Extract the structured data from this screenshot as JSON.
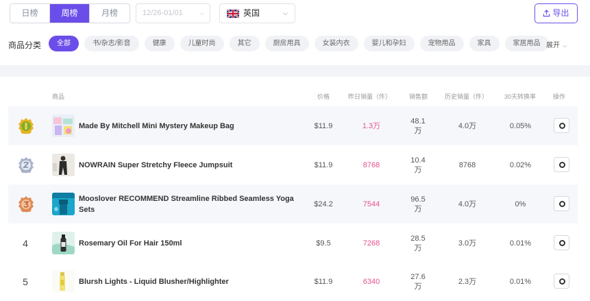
{
  "period_tabs": [
    "日榜",
    "周榜",
    "月榜"
  ],
  "active_period_index": 1,
  "date_range": "12/26-01/01",
  "country": "英国",
  "export_label": "导出",
  "category_label": "商品分类",
  "categories": [
    "全部",
    "书/杂志/影音",
    "健康",
    "儿童时尚",
    "其它",
    "厨房用具",
    "女装内衣",
    "婴儿和孕妇",
    "宠物用品",
    "家具",
    "家居用品"
  ],
  "active_category_index": 0,
  "expand_label": "展开",
  "columns": {
    "product": "商品",
    "price": "价格",
    "yesterday_sales": "昨日销量（件）",
    "revenue": "销售额",
    "history_sales": "历史销量（件）",
    "conversion": "30天转换率",
    "action": "操作"
  },
  "rows": [
    {
      "rank": "1",
      "medal": "gold-medal-icon",
      "name": "Made By Mitchell Mini Mystery Makeup Bag",
      "price": "$11.9",
      "yesterday": "1.3万",
      "revenue": "48.1 万",
      "history": "4.0万",
      "conversion": "0.05%"
    },
    {
      "rank": "2",
      "medal": "silver-medal-icon",
      "name": "NOWRAIN Super Stretchy Fleece Jumpsuit",
      "price": "$11.9",
      "yesterday": "8768",
      "revenue": "10.4 万",
      "history": "8768",
      "conversion": "0.02%"
    },
    {
      "rank": "3",
      "medal": "bronze-medal-icon",
      "name": "Mooslover RECOMMEND Streamline Ribbed Seamless Yoga Sets",
      "price": "$24.2",
      "yesterday": "7544",
      "revenue": "96.5 万",
      "history": "4.0万",
      "conversion": "0%"
    },
    {
      "rank": "4",
      "name": "Rosemary Oil For Hair 150ml",
      "price": "$9.5",
      "yesterday": "7268",
      "revenue": "28.5 万",
      "history": "3.0万",
      "conversion": "0.01%"
    },
    {
      "rank": "5",
      "name": "Blursh Lights - Liquid Blusher/Highlighter",
      "price": "$11.9",
      "yesterday": "6340",
      "revenue": "27.6 万",
      "history": "2.3万",
      "conversion": "0.01%"
    }
  ],
  "colors": {
    "accent": "#6b4eea",
    "sales_pink": "#e6508f",
    "gold": "#e7b422",
    "silver": "#a9b3c9",
    "bronze": "#e08a55"
  }
}
